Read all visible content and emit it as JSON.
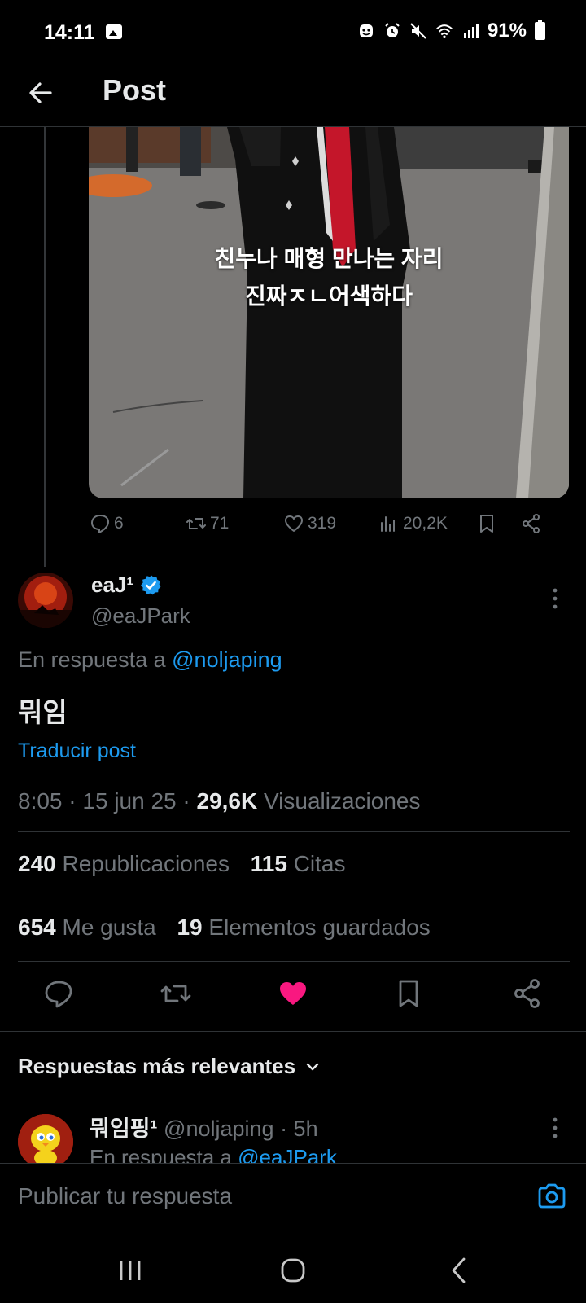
{
  "status_bar": {
    "time": "14:11",
    "battery": "91%",
    "icons": [
      "image-icon",
      "face-icon",
      "alarm-icon",
      "mute-icon",
      "wifi-icon",
      "signal-icon",
      "battery-icon"
    ]
  },
  "header": {
    "title": "Post",
    "back_icon": "arrow-left-icon"
  },
  "parent_post": {
    "image_caption_line1": "친누나 매형 만나는 자리",
    "image_caption_line2": "진짜ㅈㄴ어색하다",
    "replies": "6",
    "reposts": "71",
    "likes": "319",
    "views": "20,2K"
  },
  "post": {
    "author_name": "eaJ¹",
    "author_handle": "@eaJPark",
    "verified": true,
    "reply_to_prefix": "En respuesta a",
    "reply_to_handle": "@noljaping",
    "text": "뭐임",
    "translate_label": "Traducir post",
    "time": "8:05",
    "date": "15 jun 25",
    "views_count": "29,6K",
    "views_label": "Visualizaciones",
    "reposts_count": "240",
    "reposts_label": "Republicaciones",
    "quotes_count": "115",
    "quotes_label": "Citas",
    "likes_count": "654",
    "likes_label": "Me gusta",
    "bookmarks_count": "19",
    "bookmarks_label": "Elementos guardados",
    "liked": true
  },
  "replies_section": {
    "title": "Respuestas más relevantes"
  },
  "top_reply": {
    "author_name": "뭐임핑¹",
    "author_handle": "@noljaping",
    "age": "· 5h",
    "reply_to_prefix": "En respuesta a",
    "reply_to_handle": "@eaJPark"
  },
  "compose": {
    "placeholder": "Publicar tu respuesta"
  },
  "colors": {
    "background": "#000000",
    "accent_blue": "#1d9bf0",
    "like_pink": "#f91880",
    "muted_text": "#71767b",
    "primary_text": "#e7e9ea"
  }
}
